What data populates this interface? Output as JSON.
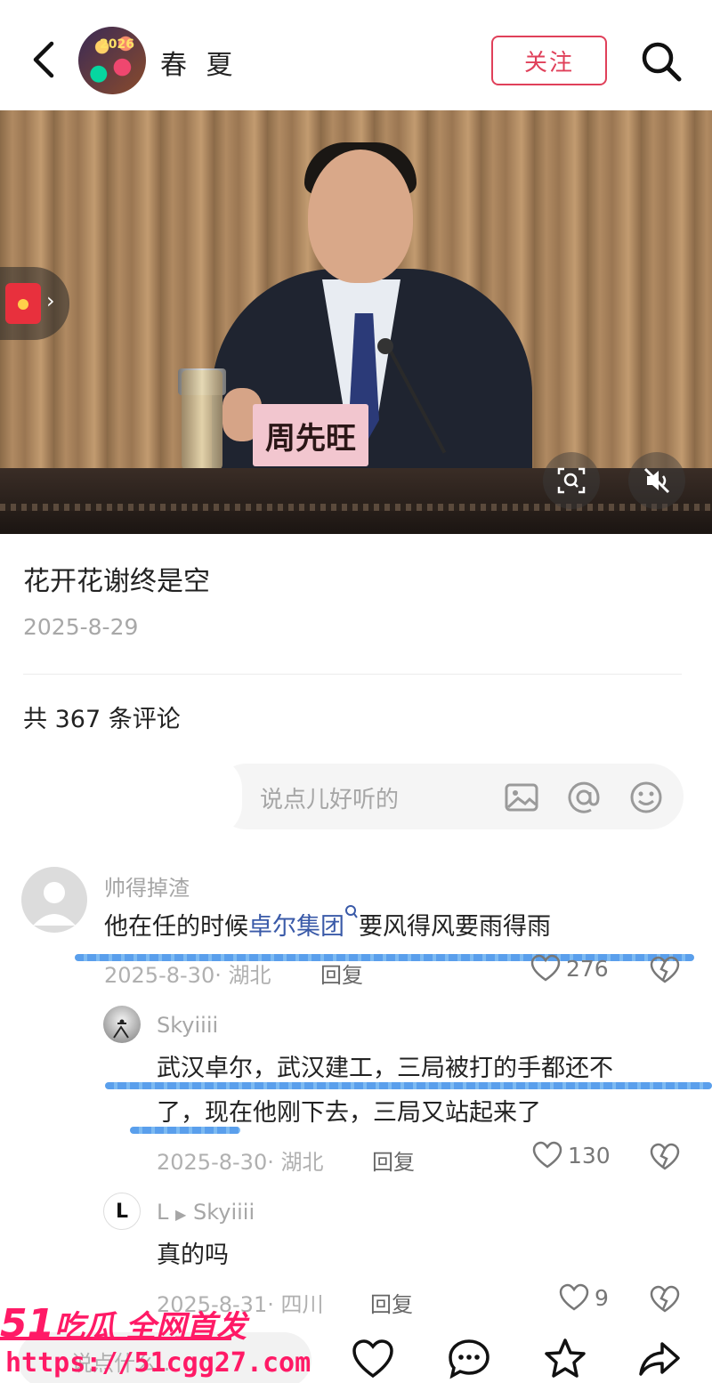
{
  "header": {
    "author_name": "春 夏",
    "avatar_year": "2026",
    "follow_label": "关注"
  },
  "media": {
    "nameplate": "周先旺"
  },
  "post": {
    "title": "花开花谢终是空",
    "date": "2025-8-29",
    "comment_count": "共 367 条评论"
  },
  "comment_input": {
    "placeholder": "说点儿好听的"
  },
  "comments": [
    {
      "user": "帅得掉渣",
      "text_before": "他在任的时候",
      "text_link": "卓尔集团",
      "text_after": "要风得风要雨得雨",
      "meta": "2025-8-30· 湖北",
      "reply_label": "回复",
      "likes": "276"
    },
    {
      "user": "Skyiiii",
      "text_line1": "武汉卓尔，武汉建工，三局被打的手都还不",
      "text_line2": "了，现在他刚下去，三局又站起来了",
      "meta": "2025-8-30· 湖北",
      "reply_label": "回复",
      "likes": "130"
    },
    {
      "user": "L",
      "reply_to": "Skyiiii",
      "avatar_letter": "L",
      "text": "真的吗",
      "meta": "2025-8-31· 四川",
      "reply_label": "回复",
      "likes": "9"
    }
  ],
  "bottom_bar": {
    "input_placeholder": "说点什么..."
  },
  "watermark": {
    "brand_num": "51",
    "brand_text": "吃瓜 全网首发",
    "url": "https://51cgg27.com"
  },
  "colors": {
    "accent": "#e0405a",
    "link": "#3a5aa8",
    "watermark": "#ff1a66",
    "highlight_stroke": "#3d8ee8"
  }
}
